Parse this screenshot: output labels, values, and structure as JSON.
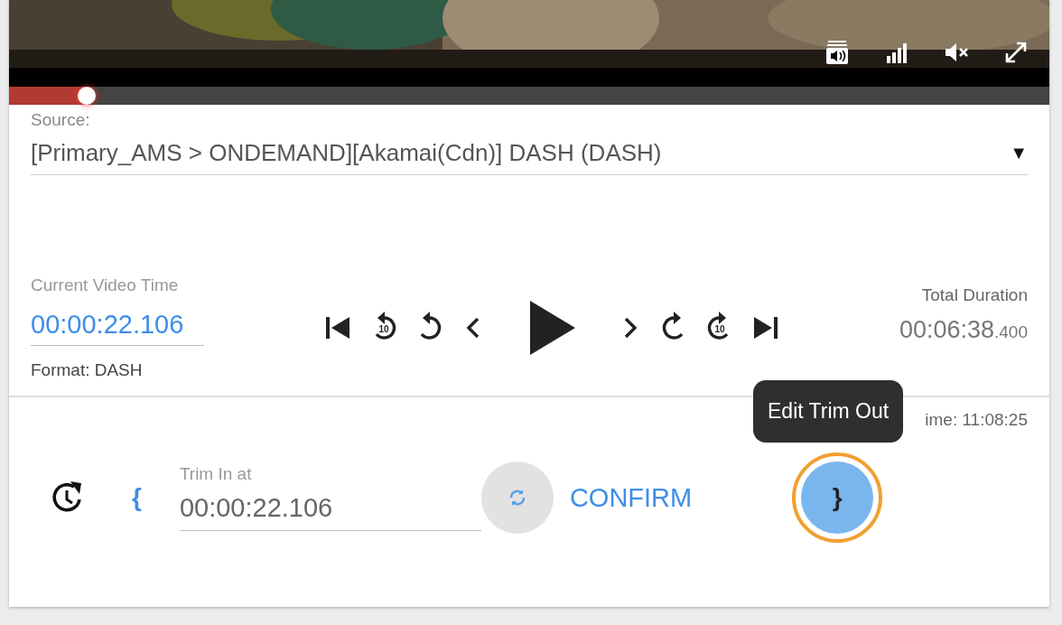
{
  "video": {
    "kind": "picture",
    "progress": {
      "level": 0.075
    }
  },
  "source": {
    "label": "Source:",
    "value": "[Primary_AMS > ONDEMAND][Akamai(Cdn)] DASH (DASH)",
    "caret": "▼"
  },
  "current_time": {
    "label": "Current Video Time",
    "value": "00:00:22.106",
    "format": "Format: DASH"
  },
  "transport": {
    "replay_label": "10",
    "forward_label": "10"
  },
  "total_duration": {
    "label": "Total Duration",
    "value": "00:06:38",
    "fraction": ".400"
  },
  "server_time": {
    "visible_text": "ime: 11:08:25"
  },
  "tooltip": {
    "text": "Edit Trim Out"
  },
  "trim": {
    "open_brace": "{",
    "label": "Trim In at",
    "value": "00:00:22.106",
    "confirm": "CONFIRM",
    "close_brace": "}",
    "close_focused": true
  }
}
